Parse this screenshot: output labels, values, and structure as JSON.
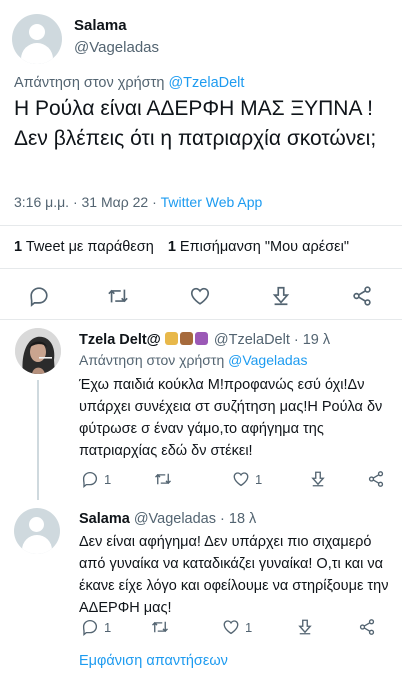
{
  "main_tweet": {
    "name": "Salama",
    "handle": "@Vageladas",
    "reply_prefix": "Απάντηση στον χρήστη",
    "reply_to": "@TzelaDelt",
    "text": "Η Ρούλα είναι ΑΔΕΡΦΗ ΜΑΣ ΞΥΠΝΑ ! Δεν βλέπεις ότι η πατριαρχία σκοτώνει;",
    "time": "3:16 μ.μ.",
    "dot": "·",
    "date": "31 Μαρ 22",
    "source": "Twitter Web App",
    "quote_count": "1",
    "quote_label": "Tweet με παράθεση",
    "like_count": "1",
    "like_label": "Επισήμανση \"Μου αρέσει\""
  },
  "reply1": {
    "name": "Tzela Delt@",
    "handle": "@TzelaDelt",
    "time": "· 19 λ",
    "reply_prefix": "Απάντηση στον χρήστη",
    "reply_to": "@Vageladas",
    "text": "Έχω παιδιά κούκλα Μ!προφανώς εσύ όχι!Δν υπάρχει συνέχεια στ συζήτηση μας!Η Ρούλα δν φύτρωσε σ έναν γάμο,το αφήγημα της πατριαρχίας εδώ δν στέκει!",
    "reply_count": "1",
    "like_count": "1"
  },
  "reply2": {
    "name": "Salama",
    "handle": "@Vageladas",
    "time": "· 18 λ",
    "text": "Δεν είναι αφήγημα! Δεν υπάρχει πιο σιχαμερό από γυναίκα να καταδικάζει γυναίκα! Ο,τι και να έκανε είχε λόγο και οφείλουμε να στηρίξουμε την ΑΔΕΡΦΗ μας!",
    "reply_count": "1",
    "like_count": "1"
  },
  "show_replies": "Εμφάνιση απαντήσεων",
  "colors": {
    "accent": "#1d9bf0",
    "secondary": "#536471",
    "divider": "#e6e9eb"
  }
}
